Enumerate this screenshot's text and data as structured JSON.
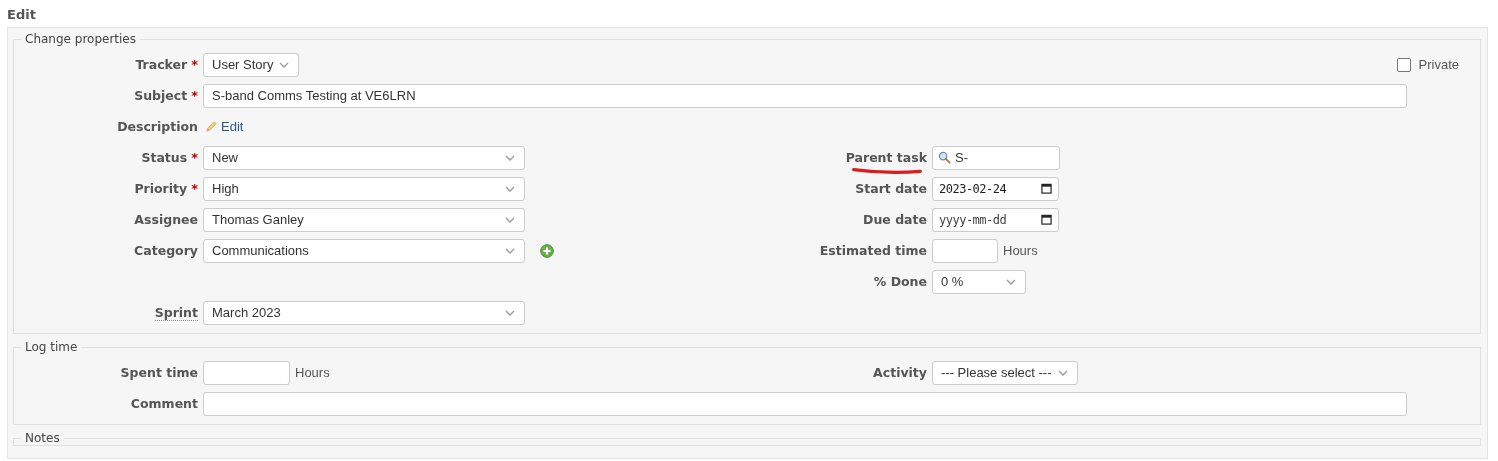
{
  "title": "Edit",
  "sections": [
    {
      "legend": "Change properties",
      "rows": [
        {
          "left": {
            "label": "Tracker",
            "required_mark": "*",
            "kind": "compact-select",
            "value": "User Story"
          },
          "right": {
            "label": "Private",
            "kind": "checkbox",
            "checked": false
          }
        },
        {
          "wide": {
            "label": "Subject",
            "required_mark": "*",
            "kind": "text",
            "value": "S-band Comms Testing at VE6LRN"
          }
        },
        {
          "left": {
            "label": "Description",
            "kind": "link",
            "value": "Edit"
          }
        },
        {
          "left": {
            "label": "Status",
            "required_mark": "*",
            "kind": "select",
            "value": "New"
          },
          "right": {
            "label": "Parent task",
            "kind": "search",
            "value": "S-",
            "annotated": true
          }
        },
        {
          "left": {
            "label": "Priority",
            "required_mark": "*",
            "kind": "select",
            "value": "High"
          },
          "right": {
            "label": "Start date",
            "kind": "date",
            "value": "2023-02-24"
          }
        },
        {
          "left": {
            "label": "Assignee",
            "kind": "select",
            "value": "Thomas Ganley"
          },
          "right": {
            "label": "Due date",
            "kind": "date",
            "placeholder": "yyyy-mm-dd"
          }
        },
        {
          "left": {
            "label": "Category",
            "kind": "select",
            "value": "Communications",
            "add_button": true
          },
          "right": {
            "label": "Estimated time",
            "kind": "hours",
            "unit": "Hours"
          }
        },
        {
          "right": {
            "label": "% Done",
            "kind": "compact-select",
            "value": "0 %"
          }
        },
        {
          "left": {
            "label": "Sprint",
            "kind": "select",
            "value": "March 2023",
            "tooltip": true
          }
        }
      ]
    },
    {
      "legend": "Log time",
      "rows": [
        {
          "left": {
            "label": "Spent time",
            "kind": "hours",
            "unit": "Hours"
          },
          "right": {
            "label": "Activity",
            "kind": "compact-select",
            "value": "--- Please select ---"
          }
        },
        {
          "wide": {
            "label": "Comment",
            "kind": "text"
          }
        }
      ]
    },
    {
      "legend": "Notes"
    }
  ]
}
